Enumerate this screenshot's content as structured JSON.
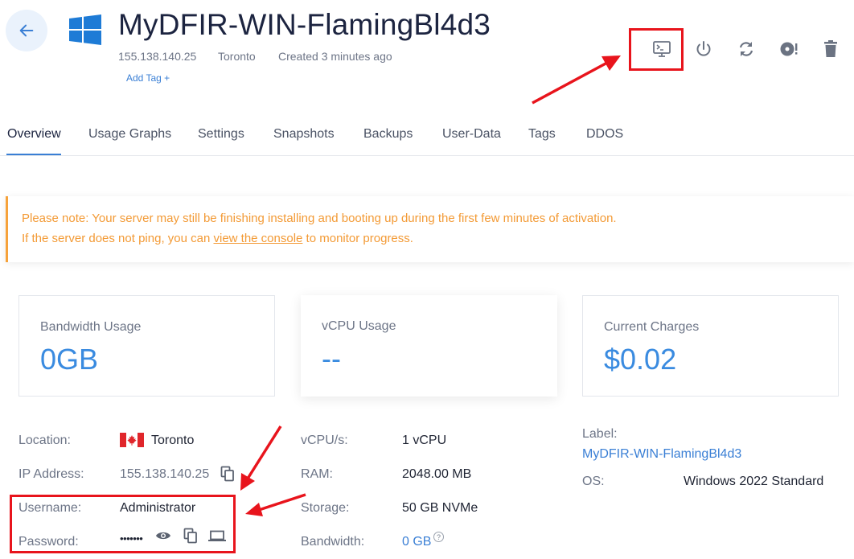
{
  "header": {
    "title": "MyDFIR-WIN-FlamingBl4d3",
    "ip": "155.138.140.25",
    "location": "Toronto",
    "created": "Created 3 minutes ago",
    "add_tag": "Add Tag +",
    "os_icon": "windows-logo-icon",
    "toolbar": [
      "console-icon",
      "power-icon",
      "restart-icon",
      "iso-icon",
      "trash-icon"
    ]
  },
  "tabs": [
    "Overview",
    "Usage Graphs",
    "Settings",
    "Snapshots",
    "Backups",
    "User-Data",
    "Tags",
    "DDOS"
  ],
  "notice": {
    "line1": "Please note: Your server may still be finishing installing and booting up during the first few minutes of activation.",
    "line2_prefix": "If the server does not ping, you can ",
    "line2_link": "view the console",
    "line2_suffix": " to monitor progress."
  },
  "cards": [
    {
      "label": "Bandwidth Usage",
      "value": "0GB"
    },
    {
      "label": "vCPU Usage",
      "value": "--"
    },
    {
      "label": "Current Charges",
      "value": "$0.02"
    }
  ],
  "details": {
    "location_label": "Location:",
    "location_value": "Toronto",
    "ip_label": "IP Address:",
    "ip_value": "155.138.140.25",
    "username_label": "Username:",
    "username_value": "Administrator",
    "password_label": "Password:",
    "password_value": "•••••••",
    "vcpu_label": "vCPU/s:",
    "vcpu_value": "1 vCPU",
    "ram_label": "RAM:",
    "ram_value": "2048.00 MB",
    "storage_label": "Storage:",
    "storage_value": "50 GB NVMe",
    "bandwidth_label": "Bandwidth:",
    "bandwidth_value": "0 GB",
    "help_mark": "?",
    "label_label": "Label:",
    "label_value": "MyDFIR-WIN-FlamingBl4d3",
    "os_label": "OS:",
    "os_value": "Windows 2022 Standard"
  },
  "colors": {
    "accent": "#3a7fd5",
    "annotation_red": "#e8141c",
    "notice_orange": "#f39a35"
  }
}
